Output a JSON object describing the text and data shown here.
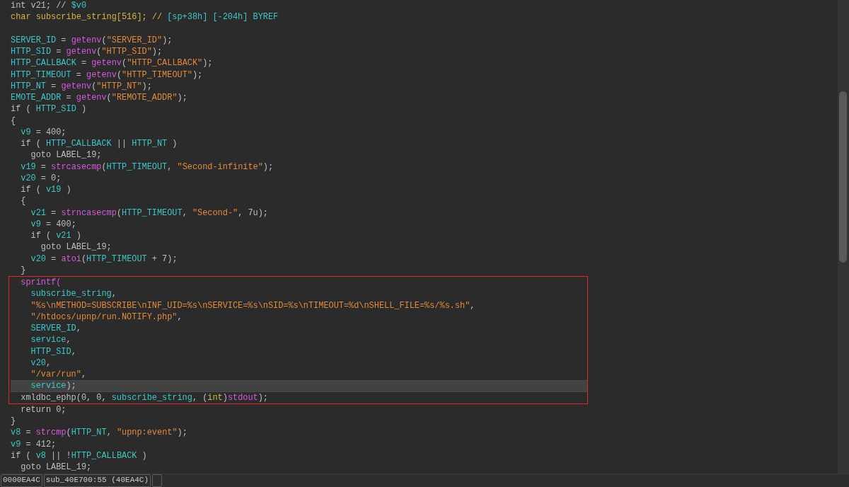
{
  "code_view": {
    "blocks": [
      {
        "kind": "plain",
        "lines": [
          {
            "kind": "code",
            "current": false,
            "tokens": [
              {
                "text": "int v21; // ",
                "kind": "plain"
              },
              {
                "text": "$v0",
                "kind": "var"
              }
            ]
          },
          {
            "kind": "code",
            "current": false,
            "tokens": [
              {
                "text": "char subscribe_string[516]; // ",
                "kind": "decl"
              },
              {
                "text": "[sp+38h] [-204h] BYREF",
                "kind": "var"
              }
            ]
          },
          {
            "kind": "blank"
          },
          {
            "kind": "code",
            "current": false,
            "tokens": [
              {
                "text": "SERVER_ID",
                "kind": "var"
              },
              {
                "text": " = ",
                "kind": "plain"
              },
              {
                "text": "getenv",
                "kind": "func"
              },
              {
                "text": "(",
                "kind": "plain"
              },
              {
                "text": "\"SERVER_ID\"",
                "kind": "string"
              },
              {
                "text": ");",
                "kind": "plain"
              }
            ]
          },
          {
            "kind": "code",
            "current": false,
            "tokens": [
              {
                "text": "HTTP_SID",
                "kind": "var"
              },
              {
                "text": " = ",
                "kind": "plain"
              },
              {
                "text": "getenv",
                "kind": "func"
              },
              {
                "text": "(",
                "kind": "plain"
              },
              {
                "text": "\"HTTP_SID\"",
                "kind": "string"
              },
              {
                "text": ");",
                "kind": "plain"
              }
            ]
          },
          {
            "kind": "code",
            "current": false,
            "tokens": [
              {
                "text": "HTTP_CALLBACK",
                "kind": "var"
              },
              {
                "text": " = ",
                "kind": "plain"
              },
              {
                "text": "getenv",
                "kind": "func"
              },
              {
                "text": "(",
                "kind": "plain"
              },
              {
                "text": "\"HTTP_CALLBACK\"",
                "kind": "string"
              },
              {
                "text": ");",
                "kind": "plain"
              }
            ]
          },
          {
            "kind": "code",
            "current": false,
            "tokens": [
              {
                "text": "HTTP_TIMEOUT",
                "kind": "var"
              },
              {
                "text": " = ",
                "kind": "plain"
              },
              {
                "text": "getenv",
                "kind": "func"
              },
              {
                "text": "(",
                "kind": "plain"
              },
              {
                "text": "\"HTTP_TIMEOUT\"",
                "kind": "string"
              },
              {
                "text": ");",
                "kind": "plain"
              }
            ]
          },
          {
            "kind": "code",
            "current": false,
            "tokens": [
              {
                "text": "HTTP_NT",
                "kind": "var"
              },
              {
                "text": " = ",
                "kind": "plain"
              },
              {
                "text": "getenv",
                "kind": "func"
              },
              {
                "text": "(",
                "kind": "plain"
              },
              {
                "text": "\"HTTP_NT\"",
                "kind": "string"
              },
              {
                "text": ");",
                "kind": "plain"
              }
            ]
          },
          {
            "kind": "code",
            "current": false,
            "tokens": [
              {
                "text": "EMOTE_ADDR",
                "kind": "var"
              },
              {
                "text": " = ",
                "kind": "plain"
              },
              {
                "text": "getenv",
                "kind": "func"
              },
              {
                "text": "(",
                "kind": "plain"
              },
              {
                "text": "\"REMOTE_ADDR\"",
                "kind": "string"
              },
              {
                "text": ");",
                "kind": "plain"
              }
            ]
          },
          {
            "kind": "code",
            "current": false,
            "tokens": [
              {
                "text": "if ( ",
                "kind": "plain"
              },
              {
                "text": "HTTP_SID",
                "kind": "var"
              },
              {
                "text": " )",
                "kind": "plain"
              }
            ]
          },
          {
            "kind": "code",
            "current": false,
            "tokens": [
              {
                "text": "{",
                "kind": "plain"
              }
            ]
          },
          {
            "kind": "code",
            "current": false,
            "tokens": [
              {
                "text": "  v9",
                "kind": "var"
              },
              {
                "text": " = 400;",
                "kind": "plain"
              }
            ]
          },
          {
            "kind": "code",
            "current": false,
            "tokens": [
              {
                "text": "  if ( ",
                "kind": "plain"
              },
              {
                "text": "HTTP_CALLBACK",
                "kind": "var"
              },
              {
                "text": " || ",
                "kind": "plain"
              },
              {
                "text": "HTTP_NT",
                "kind": "var"
              },
              {
                "text": " )",
                "kind": "plain"
              }
            ]
          },
          {
            "kind": "code",
            "current": false,
            "tokens": [
              {
                "text": "    goto LABEL_19;",
                "kind": "plain"
              }
            ]
          },
          {
            "kind": "code",
            "current": false,
            "tokens": [
              {
                "text": "  v19",
                "kind": "var"
              },
              {
                "text": " = ",
                "kind": "plain"
              },
              {
                "text": "strcasecmp",
                "kind": "func"
              },
              {
                "text": "(",
                "kind": "plain"
              },
              {
                "text": "HTTP_TIMEOUT",
                "kind": "var"
              },
              {
                "text": ", ",
                "kind": "plain"
              },
              {
                "text": "\"Second-infinite\"",
                "kind": "string"
              },
              {
                "text": ");",
                "kind": "plain"
              }
            ]
          },
          {
            "kind": "code",
            "current": false,
            "tokens": [
              {
                "text": "  v20",
                "kind": "var"
              },
              {
                "text": " = 0;",
                "kind": "plain"
              }
            ]
          },
          {
            "kind": "code",
            "current": false,
            "tokens": [
              {
                "text": "  if ( ",
                "kind": "plain"
              },
              {
                "text": "v19",
                "kind": "var"
              },
              {
                "text": " )",
                "kind": "plain"
              }
            ]
          },
          {
            "kind": "code",
            "current": false,
            "tokens": [
              {
                "text": "  {",
                "kind": "plain"
              }
            ]
          },
          {
            "kind": "code",
            "current": false,
            "tokens": [
              {
                "text": "    v21",
                "kind": "var"
              },
              {
                "text": " = ",
                "kind": "plain"
              },
              {
                "text": "strncasecmp",
                "kind": "func"
              },
              {
                "text": "(",
                "kind": "plain"
              },
              {
                "text": "HTTP_TIMEOUT",
                "kind": "var"
              },
              {
                "text": ", ",
                "kind": "plain"
              },
              {
                "text": "\"Second-\"",
                "kind": "string"
              },
              {
                "text": ", 7u);",
                "kind": "plain"
              }
            ]
          },
          {
            "kind": "code",
            "current": false,
            "tokens": [
              {
                "text": "    v9",
                "kind": "var"
              },
              {
                "text": " = 400;",
                "kind": "plain"
              }
            ]
          },
          {
            "kind": "code",
            "current": false,
            "tokens": [
              {
                "text": "    if ( ",
                "kind": "plain"
              },
              {
                "text": "v21",
                "kind": "var"
              },
              {
                "text": " )",
                "kind": "plain"
              }
            ]
          },
          {
            "kind": "code",
            "current": false,
            "tokens": [
              {
                "text": "      goto LABEL_19;",
                "kind": "plain"
              }
            ]
          },
          {
            "kind": "code",
            "current": false,
            "tokens": [
              {
                "text": "    v20",
                "kind": "var"
              },
              {
                "text": " = ",
                "kind": "plain"
              },
              {
                "text": "atoi",
                "kind": "func"
              },
              {
                "text": "(",
                "kind": "plain"
              },
              {
                "text": "HTTP_TIMEOUT",
                "kind": "var"
              },
              {
                "text": " + 7);",
                "kind": "plain"
              }
            ]
          },
          {
            "kind": "code",
            "current": false,
            "tokens": [
              {
                "text": "  }",
                "kind": "plain"
              }
            ]
          }
        ]
      },
      {
        "kind": "framed",
        "lines": [
          {
            "kind": "code",
            "current": false,
            "tokens": [
              {
                "text": "  sprintf(",
                "kind": "func"
              }
            ]
          },
          {
            "kind": "code",
            "current": false,
            "tokens": [
              {
                "text": "    subscribe_string",
                "kind": "var"
              },
              {
                "text": ",",
                "kind": "plain"
              }
            ]
          },
          {
            "kind": "code",
            "current": false,
            "tokens": [
              {
                "text": "    \"%s\\nMETHOD=SUBSCRIBE\\nINF_UID=%s\\nSERVICE=%s\\nSID=%s\\nTIMEOUT=%d\\nSHELL_FILE=%s/%s.sh\"",
                "kind": "string"
              },
              {
                "text": ",",
                "kind": "plain"
              }
            ]
          },
          {
            "kind": "code",
            "current": false,
            "tokens": [
              {
                "text": "    \"/htdocs/upnp/run.NOTIFY.php\"",
                "kind": "string"
              },
              {
                "text": ",",
                "kind": "plain"
              }
            ]
          },
          {
            "kind": "code",
            "current": false,
            "tokens": [
              {
                "text": "    SERVER_ID",
                "kind": "var"
              },
              {
                "text": ",",
                "kind": "plain"
              }
            ]
          },
          {
            "kind": "code",
            "current": false,
            "tokens": [
              {
                "text": "    service",
                "kind": "var"
              },
              {
                "text": ",",
                "kind": "plain"
              }
            ]
          },
          {
            "kind": "code",
            "current": false,
            "tokens": [
              {
                "text": "    HTTP_SID",
                "kind": "var"
              },
              {
                "text": ",",
                "kind": "plain"
              }
            ]
          },
          {
            "kind": "code",
            "current": false,
            "tokens": [
              {
                "text": "    v20",
                "kind": "var"
              },
              {
                "text": ",",
                "kind": "plain"
              }
            ]
          },
          {
            "kind": "code",
            "current": false,
            "tokens": [
              {
                "text": "    \"/var/run\"",
                "kind": "string"
              },
              {
                "text": ",",
                "kind": "plain"
              }
            ]
          },
          {
            "kind": "code",
            "current": true,
            "tokens": [
              {
                "text": "    service",
                "kind": "var"
              },
              {
                "text": ");",
                "kind": "plain"
              }
            ]
          },
          {
            "kind": "code",
            "current": false,
            "tokens": [
              {
                "text": "  xmldbc_ephp(0, 0, ",
                "kind": "plain"
              },
              {
                "text": "subscribe_string",
                "kind": "var"
              },
              {
                "text": ", (",
                "kind": "plain"
              },
              {
                "text": "int",
                "kind": "decl"
              },
              {
                "text": ")",
                "kind": "plain"
              },
              {
                "text": "stdout",
                "kind": "func"
              },
              {
                "text": ");",
                "kind": "plain"
              }
            ]
          }
        ]
      },
      {
        "kind": "plain",
        "lines": [
          {
            "kind": "code",
            "current": false,
            "tokens": [
              {
                "text": "  return 0;",
                "kind": "plain"
              }
            ]
          },
          {
            "kind": "code",
            "current": false,
            "tokens": [
              {
                "text": "}",
                "kind": "plain"
              }
            ]
          },
          {
            "kind": "code",
            "current": false,
            "tokens": [
              {
                "text": "v8",
                "kind": "var"
              },
              {
                "text": " = ",
                "kind": "plain"
              },
              {
                "text": "strcmp",
                "kind": "func"
              },
              {
                "text": "(",
                "kind": "plain"
              },
              {
                "text": "HTTP_NT",
                "kind": "var"
              },
              {
                "text": ", ",
                "kind": "plain"
              },
              {
                "text": "\"upnp:event\"",
                "kind": "string"
              },
              {
                "text": ");",
                "kind": "plain"
              }
            ]
          },
          {
            "kind": "code",
            "current": false,
            "tokens": [
              {
                "text": "v9",
                "kind": "var"
              },
              {
                "text": " = 412;",
                "kind": "plain"
              }
            ]
          },
          {
            "kind": "code",
            "current": false,
            "tokens": [
              {
                "text": "if ( ",
                "kind": "plain"
              },
              {
                "text": "v8",
                "kind": "var"
              },
              {
                "text": " || !",
                "kind": "plain"
              },
              {
                "text": "HTTP_CALLBACK",
                "kind": "var"
              },
              {
                "text": " )",
                "kind": "plain"
              }
            ]
          },
          {
            "kind": "code",
            "current": false,
            "tokens": [
              {
                "text": "  goto LABEL_19;",
                "kind": "plain"
              }
            ]
          }
        ]
      }
    ]
  },
  "status_bar": {
    "address": "0000EA4C",
    "location": "sub_40E700:55 (40EA4C)"
  }
}
